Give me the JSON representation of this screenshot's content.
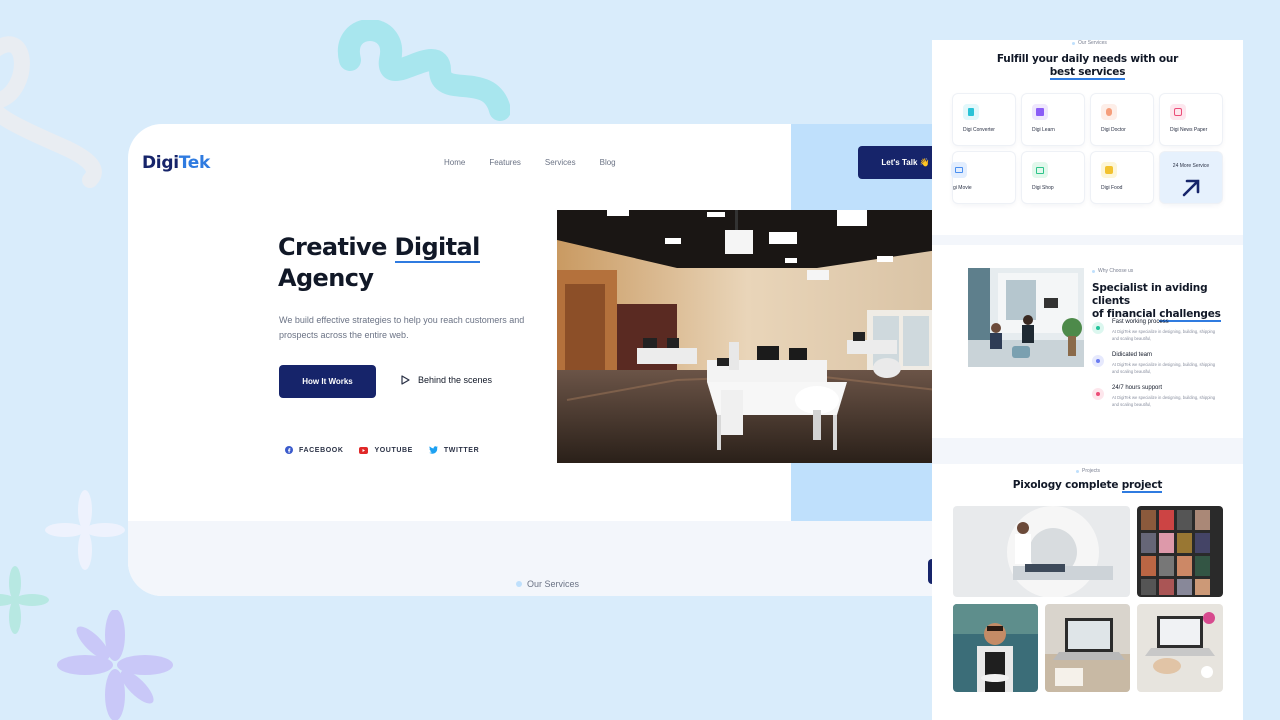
{
  "main": {
    "logo_part1": "Digi",
    "logo_part2": "Tek",
    "nav": [
      "Home",
      "Features",
      "Services",
      "Blog"
    ],
    "cta_label": "Let's Talk 👋",
    "hero_title_line1_a": "Creative ",
    "hero_title_line1_b": "Digital",
    "hero_title_line2": "Agency",
    "hero_description": "We build effective strategies to help you reach customers and prospects across the entire web.",
    "primary_button": "How It Works",
    "secondary_link": "Behind the scenes",
    "socials": [
      "FACEBOOK",
      "YOUTUBE",
      "TWITTER"
    ],
    "section_label": "Our Services",
    "scroll_top_icon": "arrow-up-icon"
  },
  "side": {
    "services_label": "Our Services",
    "services_title_line1": "Fulfill your daily needs with our",
    "services_title_line2": "best services",
    "services": [
      {
        "label": "Digi Converter",
        "color": "#e2f8fb",
        "icon": "#2bc3d6"
      },
      {
        "label": "Digi Learn",
        "color": "#efe7fd",
        "icon": "#8b5cf6"
      },
      {
        "label": "Digi Doctor",
        "color": "#fdeee8",
        "icon": "#f59e7b"
      },
      {
        "label": "Digi News Paper",
        "color": "#fde7ee",
        "icon": "#ec4d78"
      },
      {
        "label": "gi Movie",
        "color": "#e3eefe",
        "icon": "#4a8ff0"
      },
      {
        "label": "Digi Shop",
        "color": "#e2f8ec",
        "icon": "#2dc48a"
      },
      {
        "label": "Digi Food",
        "color": "#fdf6d8",
        "icon": "#f2c230"
      }
    ],
    "more_services": "24 More Service",
    "why_label": "Why Choose us",
    "why_title_line1": "Specialist in aviding clients",
    "why_title_line2a": "of financial ",
    "why_title_line2b": "challenges",
    "features": [
      {
        "title": "Fast working process",
        "desc": "At DigiTek we specialize in designing, building, shipping and scaling beautiful,",
        "color": "#dcf7ef",
        "dot": "#22c39a"
      },
      {
        "title": "Didicated team",
        "desc": "At DigiTek we specialize in designing, building, shipping and scaling beautiful,",
        "color": "#e6e9fd",
        "dot": "#6a7cf0"
      },
      {
        "title": "24/7 hours support",
        "desc": "At DigiTek we specialize in designing, building, shipping and scaling beautiful,",
        "color": "#fde6ec",
        "dot": "#ec4d78"
      }
    ],
    "projects_label": "Projects",
    "projects_title_a": "Pixology complete ",
    "projects_title_b": "project"
  }
}
